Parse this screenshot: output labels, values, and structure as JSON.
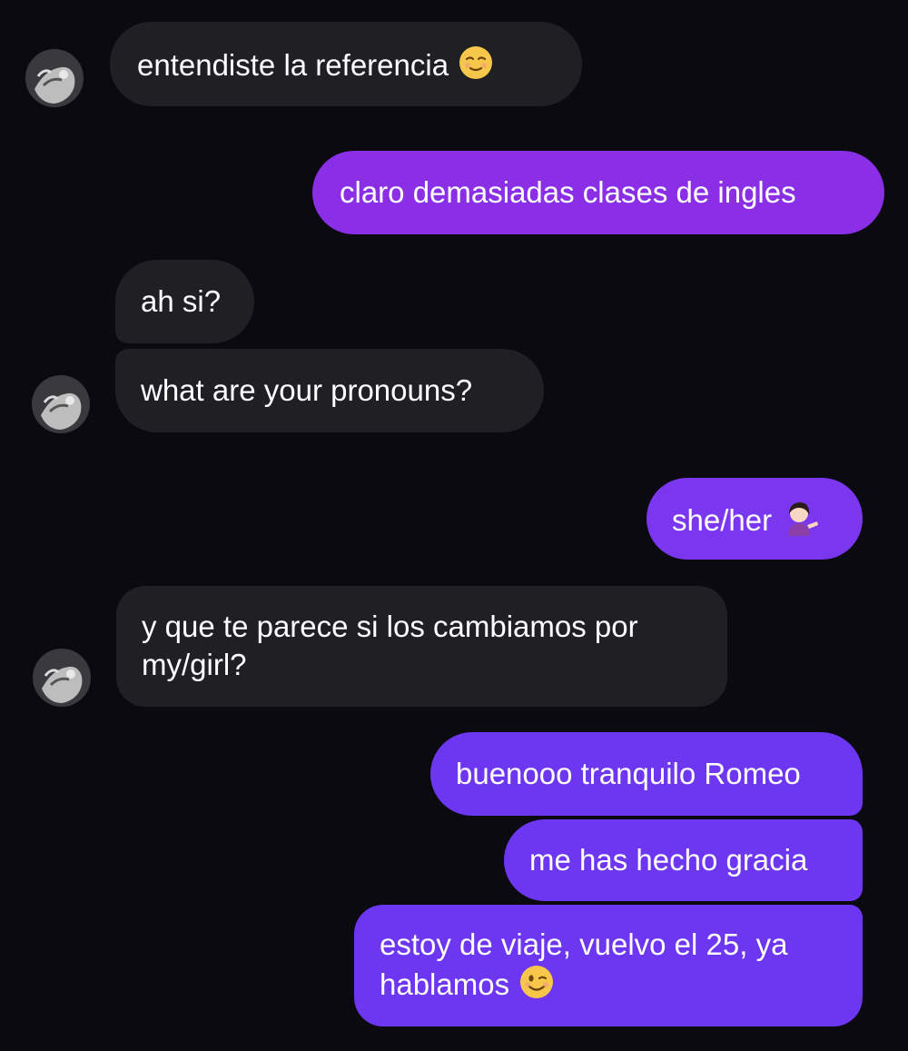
{
  "colors": {
    "background": "#0a0a10",
    "incoming_bubble": "#1f1f24",
    "outgoing_pink_purple": "#8a2fe6",
    "outgoing_purple": "#7b36ef",
    "outgoing_blue_purple": "#6d36f0"
  },
  "messages": [
    {
      "direction": "incoming",
      "text": "entendiste la referencia",
      "emoji": "relieved-face-emoji"
    },
    {
      "direction": "outgoing",
      "text": "claro demasiadas clases de ingles"
    },
    {
      "direction": "incoming",
      "text": "ah si?"
    },
    {
      "direction": "incoming",
      "text": "what are your pronouns?"
    },
    {
      "direction": "outgoing",
      "text": "she/her",
      "emoji": "person-tipping-hand-emoji"
    },
    {
      "direction": "incoming",
      "text_line1": "y que te parece si los cambiamos por",
      "text_line2": "my/girl?"
    },
    {
      "direction": "outgoing",
      "text": "buenooo tranquilo Romeo"
    },
    {
      "direction": "outgoing",
      "text": "me has hecho gracia"
    },
    {
      "direction": "outgoing",
      "text_line1": "estoy de viaje, vuelvo el 25, ya",
      "text_line2": "hablamos",
      "emoji": "winking-face-emoji"
    }
  ],
  "avatars": [
    {
      "icon": "contact-avatar"
    },
    {
      "icon": "contact-avatar"
    },
    {
      "icon": "contact-avatar"
    }
  ]
}
